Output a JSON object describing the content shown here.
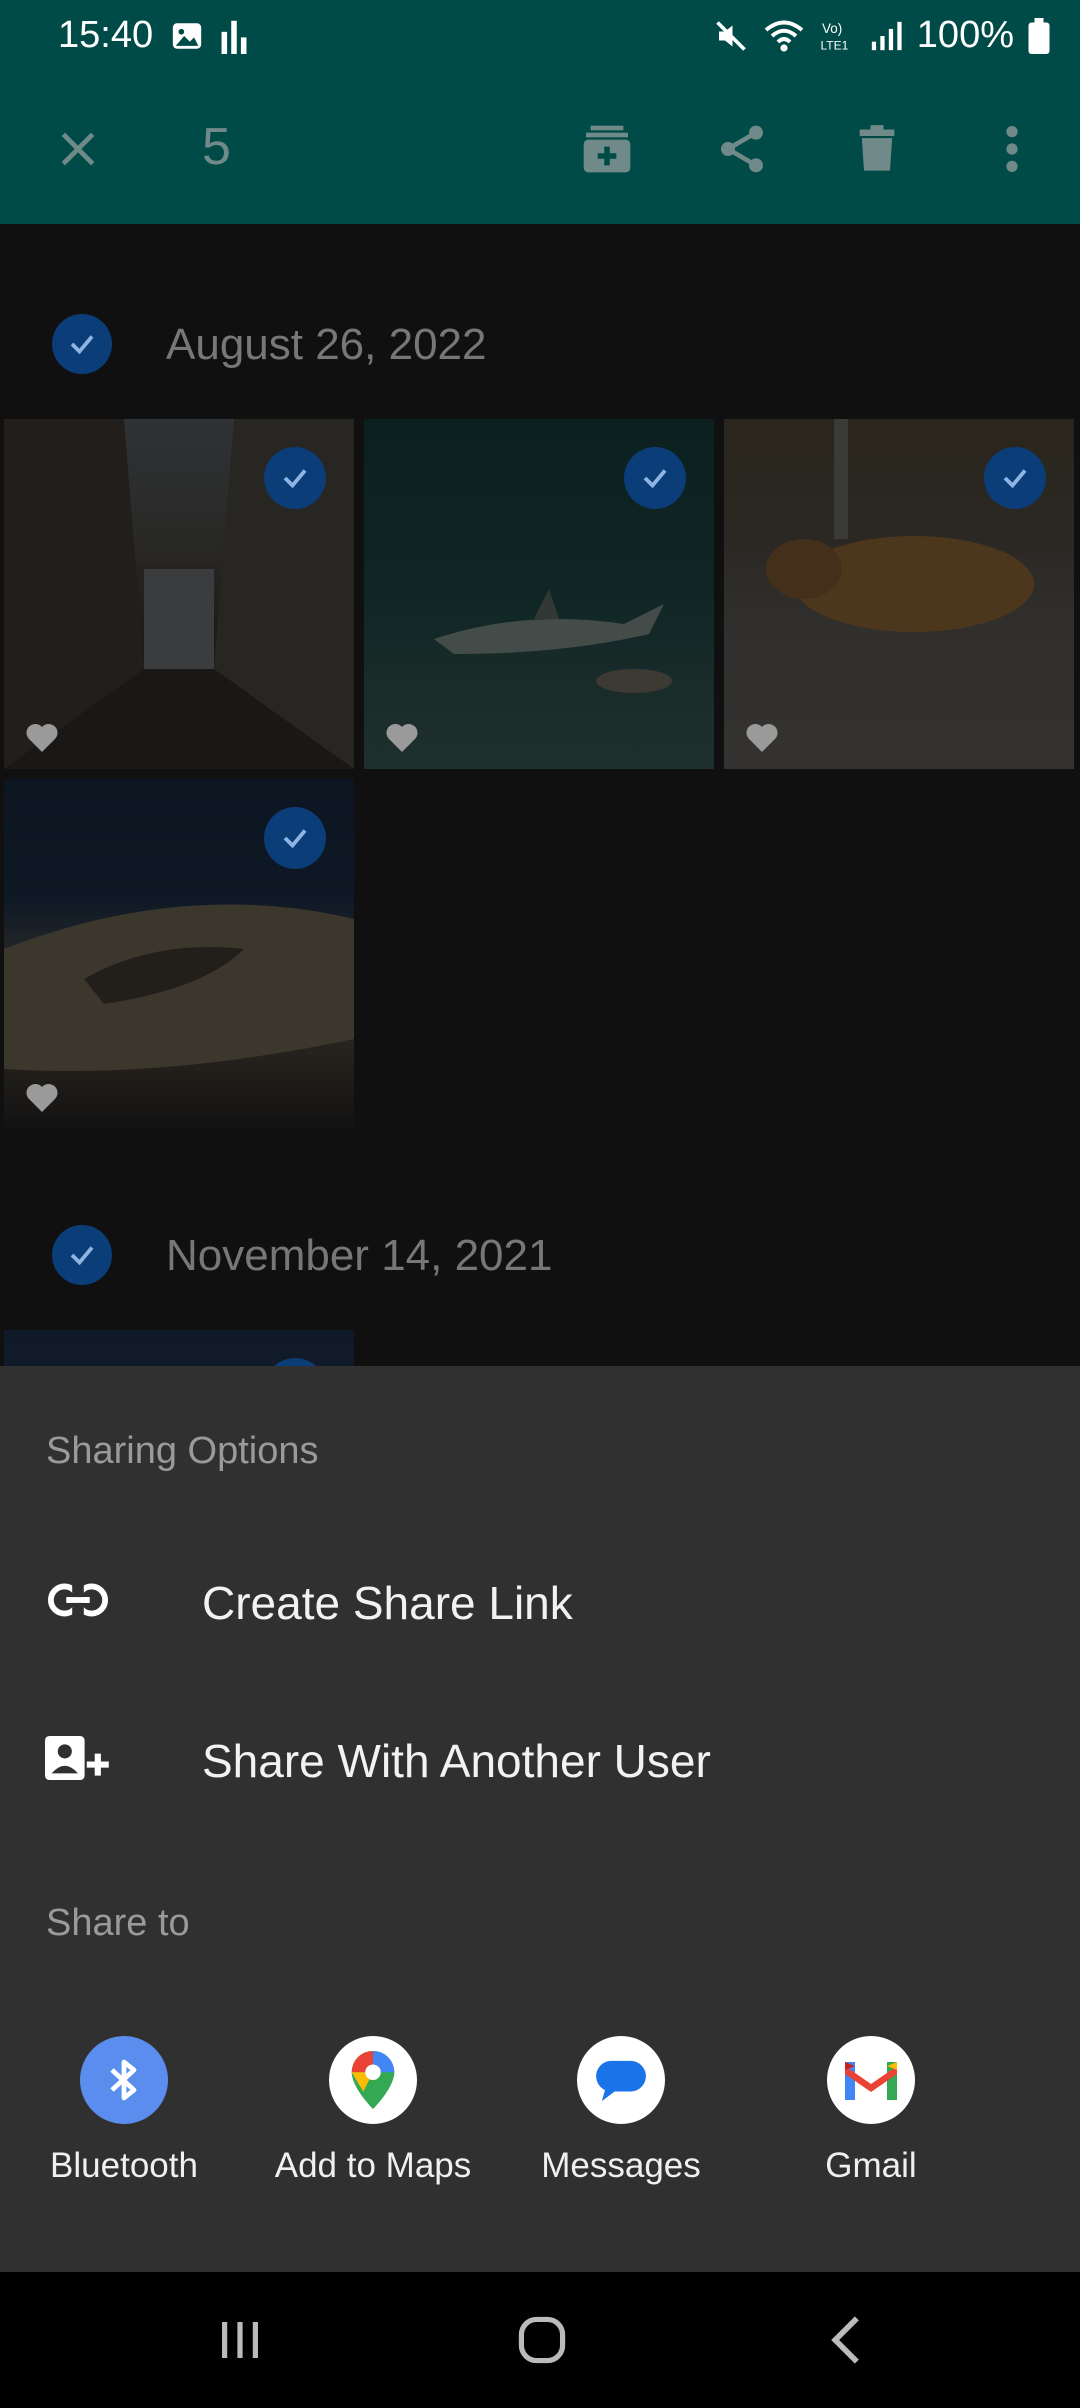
{
  "status_bar": {
    "time": "15:40",
    "battery": "100%",
    "left_icons": [
      "image-notification-icon",
      "equalizer-notification-icon"
    ],
    "right_icons": [
      "mute-icon",
      "wifi-icon",
      "volte-icon",
      "signal-icon",
      "battery-icon"
    ]
  },
  "app_bar": {
    "selected_count": "5",
    "actions": [
      "close-icon",
      "add-to-album-icon",
      "share-icon",
      "delete-icon",
      "more-options-icon"
    ],
    "color": "#004b47"
  },
  "gallery": {
    "groups": [
      {
        "date": "August 26, 2022",
        "photos": [
          "street",
          "shark-aquarium",
          "sleeping-dog",
          "coastal-rock"
        ]
      },
      {
        "date": "November 14, 2021",
        "photos": [
          "sky"
        ]
      }
    ],
    "selection_color": "#0b3d78"
  },
  "sheet": {
    "sharing_options_heading": "Sharing Options",
    "create_share_link": "Create Share Link",
    "share_with_user": "Share With Another User",
    "share_to_heading": "Share to",
    "apps": [
      {
        "label": "Bluetooth",
        "icon": "bluetooth-icon"
      },
      {
        "label": "Add to Maps",
        "icon": "google-maps-icon"
      },
      {
        "label": "Messages",
        "icon": "messages-icon"
      },
      {
        "label": "Gmail",
        "icon": "gmail-icon"
      }
    ]
  },
  "nav_bar": {
    "buttons": [
      "recents-icon",
      "home-icon",
      "back-icon"
    ]
  }
}
